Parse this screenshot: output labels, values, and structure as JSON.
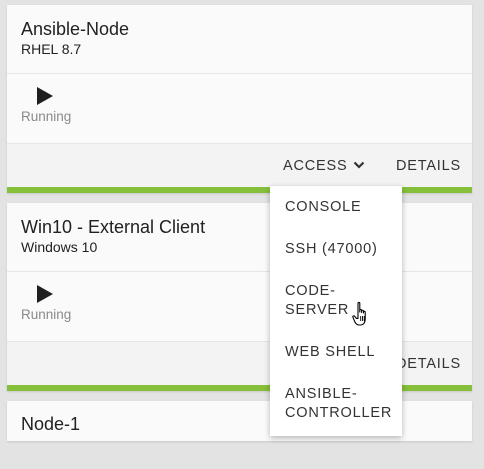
{
  "cards": [
    {
      "title": "Ansible-Node",
      "subtitle": "RHEL 8.7",
      "status": "Running",
      "access_label": "ACCESS",
      "details_label": "DETAILS"
    },
    {
      "title": "Win10 - External Client",
      "subtitle": "Windows 10",
      "status": "Running",
      "details_label": "DETAILS"
    },
    {
      "title": "Node-1"
    }
  ],
  "access_menu": {
    "items": [
      {
        "label": "CONSOLE"
      },
      {
        "label": "SSH (47000)"
      },
      {
        "label": "CODE-SERVER"
      },
      {
        "label": "WEB SHELL"
      },
      {
        "label": "ANSIBLE-CONTROLLER"
      }
    ]
  },
  "icons": {
    "play": "play-icon",
    "chevron": "chevron-down-icon",
    "cursor": "hand-pointer-icon"
  },
  "colors": {
    "accent": "#86c03a",
    "background": "#e3e3e3",
    "card": "#fafafa",
    "status_text": "#8a8a8a"
  }
}
